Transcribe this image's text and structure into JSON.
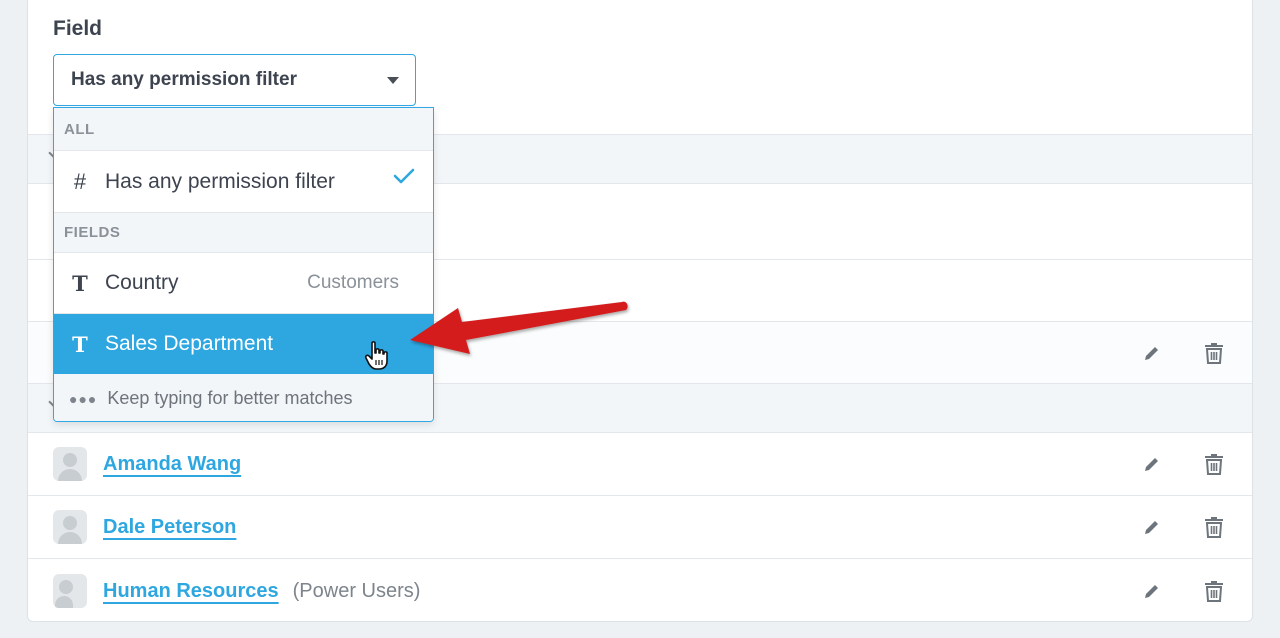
{
  "field": {
    "label": "Field",
    "selected_value": "Has any permission filter"
  },
  "dropdown": {
    "section_all": "ALL",
    "all_item": {
      "label": "Has any permission filter",
      "icon": "hash-icon",
      "checked": true
    },
    "section_fields": "FIELDS",
    "items": [
      {
        "label": "Country",
        "meta": "Customers",
        "icon": "text-type-icon",
        "selected": false
      },
      {
        "label": "Sales Department",
        "meta": "",
        "icon": "text-type-icon",
        "selected": true
      }
    ],
    "hint": "Keep typing for better matches"
  },
  "members": [
    {
      "name": "Amanda Wang",
      "note": ""
    },
    {
      "name": "Dale Peterson",
      "note": ""
    },
    {
      "name": "Human Resources",
      "note": "(Power Users)"
    }
  ],
  "colors": {
    "accent": "#2ea7e0",
    "annotation_arrow": "#d41e1e"
  }
}
